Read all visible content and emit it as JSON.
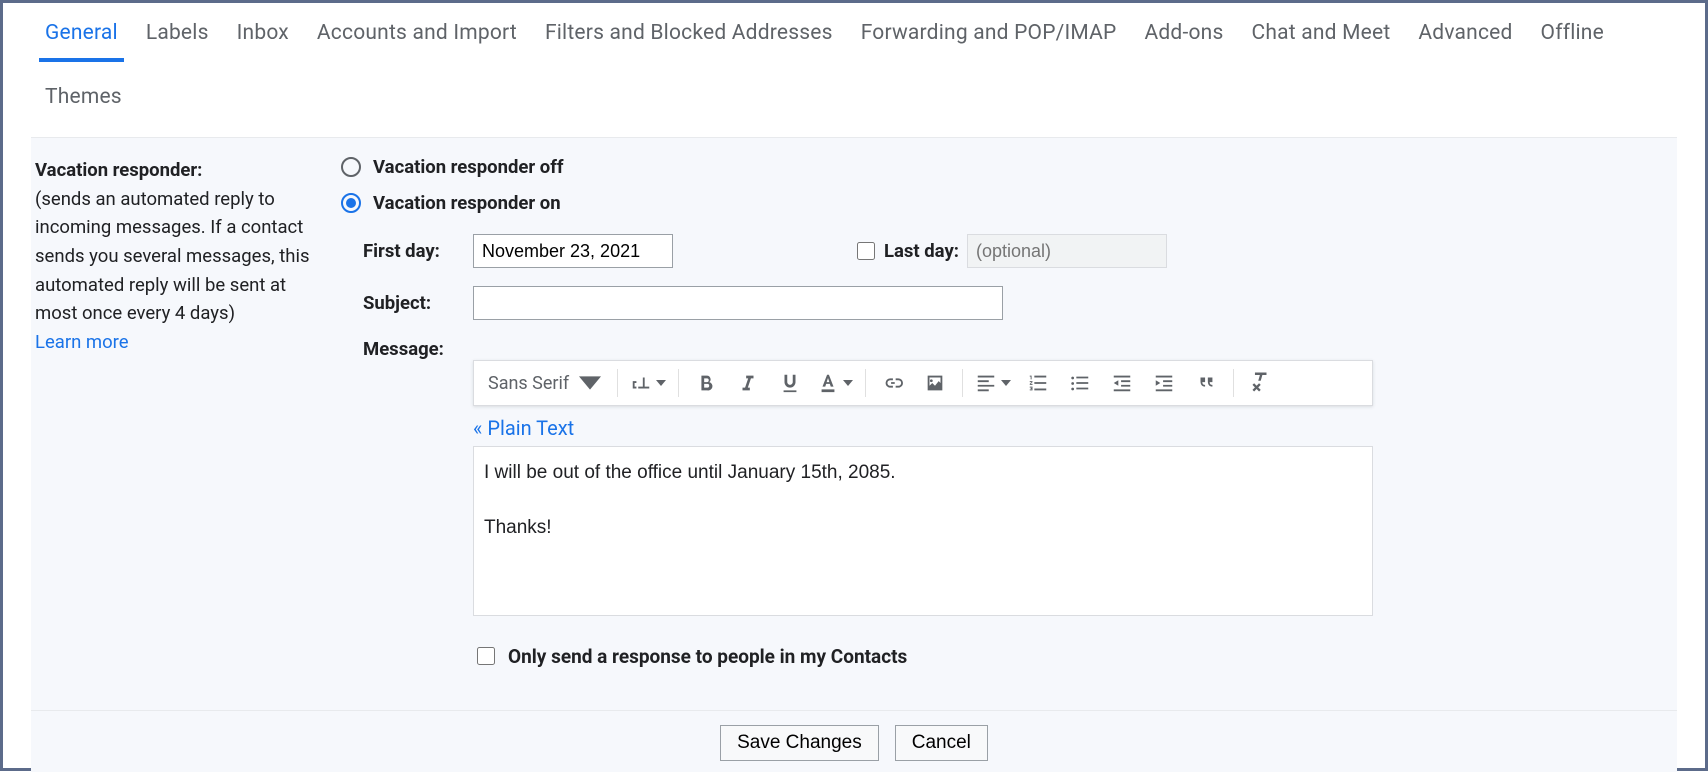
{
  "tabs": {
    "general": "General",
    "labels": "Labels",
    "inbox": "Inbox",
    "accounts": "Accounts and Import",
    "filters": "Filters and Blocked Addresses",
    "forwarding": "Forwarding and POP/IMAP",
    "addons": "Add-ons",
    "chat": "Chat and Meet",
    "advanced": "Advanced",
    "offline": "Offline",
    "themes": "Themes"
  },
  "vacation": {
    "title": "Vacation responder:",
    "desc": "(sends an automated reply to incoming messages. If a contact sends you several messages, this automated reply will be sent at most once every 4 days)",
    "learn_more": "Learn more",
    "off_label": "Vacation responder off",
    "on_label": "Vacation responder on",
    "first_day_label": "First day:",
    "first_day_value": "November 23, 2021",
    "last_day_label": "Last day:",
    "last_day_placeholder": "(optional)",
    "subject_label": "Subject:",
    "subject_value": "",
    "message_label": "Message:",
    "font_name": "Sans Serif",
    "plain_text_link": "« Plain Text",
    "message_body": "I will be out of the office until January 15th, 2085.\n\nThanks!",
    "contacts_only_label": "Only send a response to people in my Contacts"
  },
  "footer": {
    "save": "Save Changes",
    "cancel": "Cancel"
  }
}
